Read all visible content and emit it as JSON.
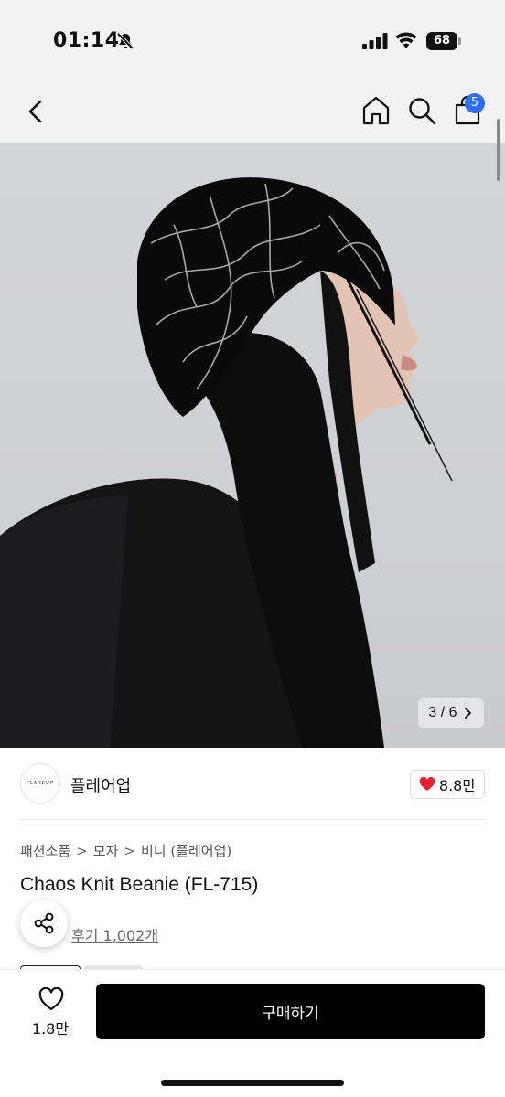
{
  "status_bar": {
    "time": "01:14",
    "battery": "68"
  },
  "nav": {
    "cart_count": "5"
  },
  "gallery": {
    "counter": "3 / 6"
  },
  "brand": {
    "logo_text": "FLAREUP",
    "name": "플레어업",
    "like_count": "8.8만"
  },
  "breadcrumb": [
    "패션소품",
    "모자",
    "비니 (플레어업)"
  ],
  "breadcrumb_separator": ">",
  "product": {
    "title": "Chaos Knit Beanie (FL-715)",
    "review_link": "후기 1,002개"
  },
  "bottom_bar": {
    "wish_count": "1.8만",
    "buy_label": "구매하기"
  },
  "colors": {
    "badge": "#2f6df6",
    "heart": "#e8202f",
    "buy_button": "#000000"
  },
  "icons": [
    "back-icon",
    "home-icon",
    "search-icon",
    "cart-icon",
    "heart-icon",
    "share-icon",
    "mute-icon",
    "signal-icon",
    "wifi-icon"
  ]
}
